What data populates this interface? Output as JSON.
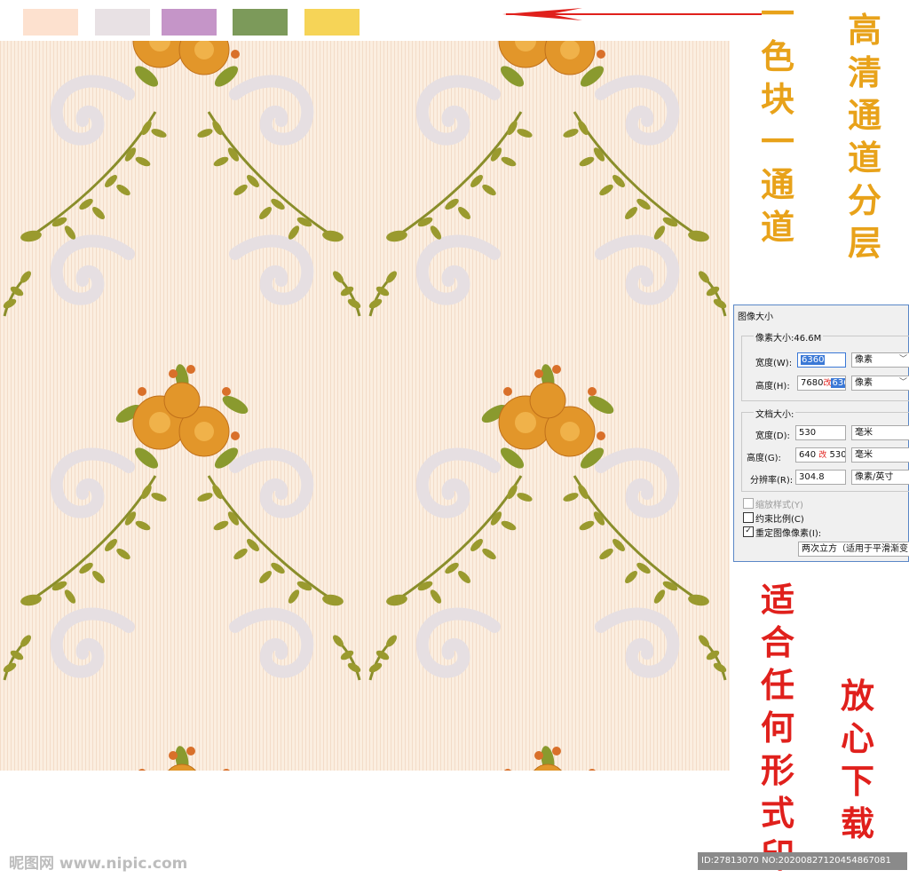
{
  "swatches": {
    "colors": [
      "#fde1cf",
      "#e8e1e4",
      "#c595c8",
      "#7c9a5a",
      "#f6d457"
    ]
  },
  "pattern": {
    "background": "#fbeee0",
    "damask_color": "#e6dfe2",
    "leaf_color": "#8a8e2a",
    "flower_color": "#e2962a"
  },
  "vertical_texts": {
    "left_gold": "一色块一通道",
    "right_gold": "高清通道分层",
    "left_red": "适合任何形式印",
    "right_red": "放心下载"
  },
  "dialog": {
    "title": "图像大小",
    "pixel_size_label": "像素大小:46.6M",
    "width_label": "宽度(W):",
    "width_value": "6360",
    "width_unit": "像素",
    "height_label": "高度(H):",
    "height_old": "7680",
    "height_change_mark": "改",
    "height_value": "6360",
    "height_unit": "像素",
    "doc_size_label": "文档大小:",
    "doc_width_label": "宽度(D):",
    "doc_width_value": "530",
    "doc_width_unit": "毫米",
    "doc_height_label": "高度(G):",
    "doc_height_old": "640",
    "doc_height_change_mark": "改",
    "doc_height_value": "530",
    "doc_height_unit": "毫米",
    "resolution_label": "分辨率(R):",
    "resolution_value": "304.8",
    "resolution_unit": "像素/英寸",
    "scale_styles_label": "缩放样式(Y)",
    "constrain_label": "约束比例(C)",
    "resample_label": "重定图像像素(I):",
    "resample_method": "两次立方（适用于平滑渐变"
  },
  "footer": {
    "watermark": "昵图网 www.nipic.com",
    "id_text": "ID:27813070 NO:20200827120454867081"
  }
}
